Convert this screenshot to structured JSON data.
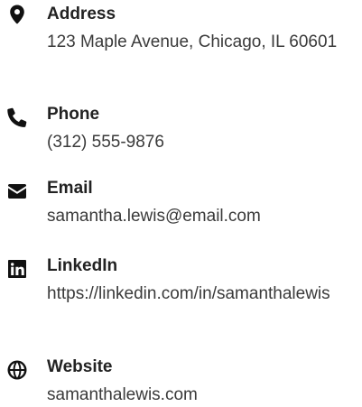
{
  "contacts": [
    {
      "label": "Address",
      "value": "123 Maple Avenue, Chicago, IL 60601",
      "icon": "location-pin-icon"
    },
    {
      "label": "Phone",
      "value": "(312) 555-9876",
      "icon": "phone-icon"
    },
    {
      "label": "Email",
      "value": "samantha.lewis@email.com",
      "icon": "envelope-icon"
    },
    {
      "label": "LinkedIn",
      "value": "https://linkedin.com/in/samanthalewis",
      "icon": "linkedin-icon"
    },
    {
      "label": "Website",
      "value": "samanthalewis.com",
      "icon": "globe-icon"
    }
  ],
  "colors": {
    "icon": "#111111",
    "label": "#222222",
    "text": "#3a3a3a"
  }
}
